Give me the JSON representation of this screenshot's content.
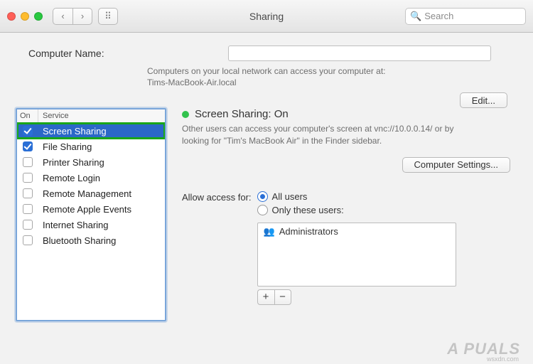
{
  "window": {
    "title": "Sharing"
  },
  "toolbar": {
    "back_glyph": "‹",
    "forward_glyph": "›",
    "grid_glyph": "⠿",
    "search_icon": "🔍",
    "search_placeholder": "Search"
  },
  "computer": {
    "label": "Computer Name:",
    "value": "",
    "help1": "Computers on your local network can access your computer at:",
    "help2": "Tims-MacBook-Air.local",
    "edit_label": "Edit..."
  },
  "services": {
    "hdr_on": "On",
    "hdr_service": "Service",
    "items": [
      {
        "label": "Screen Sharing",
        "checked": true,
        "selected": true,
        "highlight": true
      },
      {
        "label": "File Sharing",
        "checked": true,
        "selected": false,
        "highlight": false
      },
      {
        "label": "Printer Sharing",
        "checked": false,
        "selected": false,
        "highlight": false
      },
      {
        "label": "Remote Login",
        "checked": false,
        "selected": false,
        "highlight": false
      },
      {
        "label": "Remote Management",
        "checked": false,
        "selected": false,
        "highlight": false
      },
      {
        "label": "Remote Apple Events",
        "checked": false,
        "selected": false,
        "highlight": false
      },
      {
        "label": "Internet Sharing",
        "checked": false,
        "selected": false,
        "highlight": false
      },
      {
        "label": "Bluetooth Sharing",
        "checked": false,
        "selected": false,
        "highlight": false
      }
    ]
  },
  "detail": {
    "status_title": "Screen Sharing: On",
    "description": "Other users can access your computer's screen at vnc://10.0.0.14/ or by looking for \"Tim's MacBook Air\" in the Finder sidebar.",
    "settings_label": "Computer Settings...",
    "allow_label": "Allow access for:",
    "opt_all": "All users",
    "opt_only": "Only these users:",
    "users": [
      "Administrators"
    ],
    "users_icon": "👥",
    "plus": "+",
    "minus": "−"
  },
  "watermark": {
    "brand": "A  PUALS",
    "site": "wsxdn.com"
  }
}
